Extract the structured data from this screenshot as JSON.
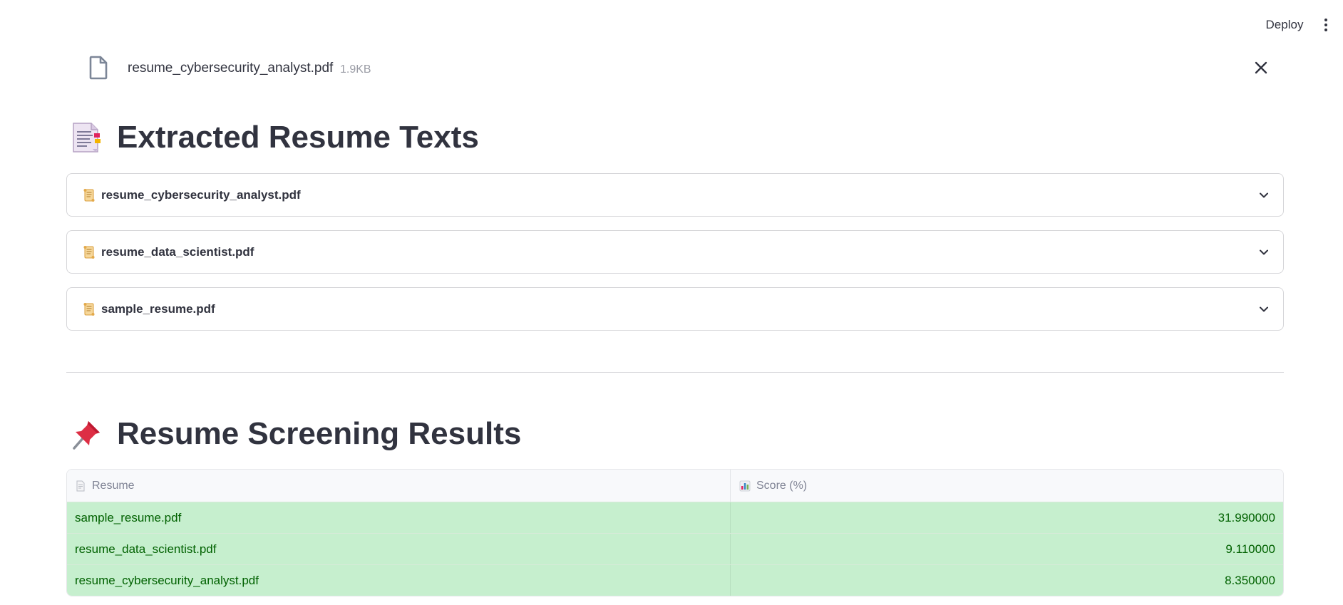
{
  "header": {
    "deploy_label": "Deploy",
    "menu_icon": "more-vertical-icon"
  },
  "uploaded_file": {
    "icon": "file-icon",
    "name": "resume_cybersecurity_analyst.pdf",
    "size": "1.9KB",
    "remove_icon": "close-icon"
  },
  "extracted_section": {
    "icon": "page-with-curl-emoji",
    "title": "Extracted Resume Texts",
    "expanders": [
      {
        "icon": "scroll-emoji",
        "label": "resume_cybersecurity_analyst.pdf"
      },
      {
        "icon": "scroll-emoji",
        "label": "resume_data_scientist.pdf"
      },
      {
        "icon": "scroll-emoji",
        "label": "sample_resume.pdf"
      }
    ]
  },
  "results_section": {
    "icon": "pushpin-emoji",
    "title": "Resume Screening Results",
    "table": {
      "columns": [
        {
          "icon": "page-facing-up-emoji",
          "label": "Resume"
        },
        {
          "icon": "bar-chart-emoji",
          "label": "Score (%)"
        }
      ],
      "rows": [
        [
          "sample_resume.pdf",
          "31.990000"
        ],
        [
          "resume_data_scientist.pdf",
          "9.110000"
        ],
        [
          "resume_cybersecurity_analyst.pdf",
          "8.350000"
        ]
      ],
      "row_background": "#c6efce",
      "row_text_color": "#006100"
    }
  }
}
